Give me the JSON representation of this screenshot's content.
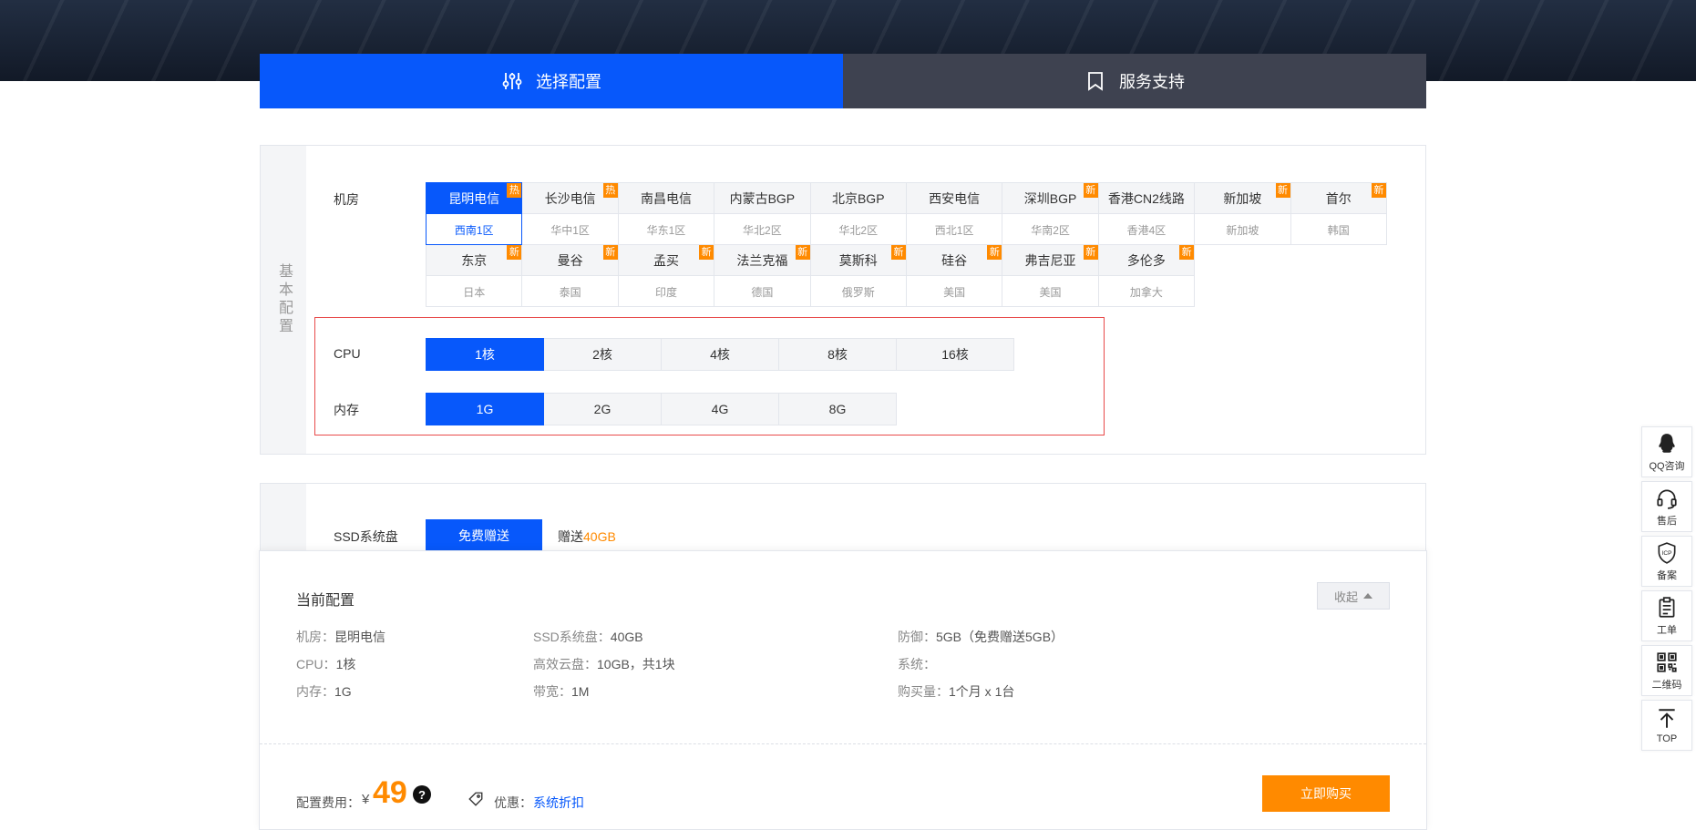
{
  "tabs": [
    {
      "label": "选择配置",
      "icon": "sliders-icon",
      "active": true
    },
    {
      "label": "服务支持",
      "icon": "bookmark-icon",
      "active": false
    }
  ],
  "basic": {
    "side_label": "基本配置",
    "datacenter_label": "机房",
    "datacenters": [
      [
        {
          "name": "昆明电信",
          "zone": "西南1区",
          "badge": "热",
          "selected": true
        },
        {
          "name": "长沙电信",
          "zone": "华中1区",
          "badge": "热"
        },
        {
          "name": "南昌电信",
          "zone": "华东1区",
          "badge": ""
        },
        {
          "name": "内蒙古BGP",
          "zone": "华北2区",
          "badge": ""
        },
        {
          "name": "北京BGP",
          "zone": "华北2区",
          "badge": ""
        },
        {
          "name": "西安电信",
          "zone": "西北1区",
          "badge": ""
        },
        {
          "name": "深圳BGP",
          "zone": "华南2区",
          "badge": "新"
        },
        {
          "name": "香港CN2线路",
          "zone": "香港4区",
          "badge": ""
        },
        {
          "name": "新加坡",
          "zone": "新加坡",
          "badge": "新"
        },
        {
          "name": "首尔",
          "zone": "韩国",
          "badge": "新"
        }
      ],
      [
        {
          "name": "东京",
          "zone": "日本",
          "badge": "新"
        },
        {
          "name": "曼谷",
          "zone": "泰国",
          "badge": "新"
        },
        {
          "name": "孟买",
          "zone": "印度",
          "badge": "新"
        },
        {
          "name": "法兰克福",
          "zone": "德国",
          "badge": "新"
        },
        {
          "name": "莫斯科",
          "zone": "俄罗斯",
          "badge": "新"
        },
        {
          "name": "硅谷",
          "zone": "美国",
          "badge": "新"
        },
        {
          "name": "弗吉尼亚",
          "zone": "美国",
          "badge": "新"
        },
        {
          "name": "多伦多",
          "zone": "加拿大",
          "badge": "新"
        }
      ]
    ],
    "cpu_label": "CPU",
    "cpu_options": [
      "1核",
      "2核",
      "4核",
      "8核",
      "16核"
    ],
    "cpu_selected": 0,
    "mem_label": "内存",
    "mem_options": [
      "1G",
      "2G",
      "4G",
      "8G"
    ],
    "mem_selected": 0
  },
  "storage": {
    "ssd_label": "SSD系统盘",
    "ssd_free": "免费赠送",
    "ssd_gift_prefix": "赠送",
    "ssd_gift_value": "40GB"
  },
  "config": {
    "title": "当前配置",
    "collapse": "收起",
    "col1": [
      {
        "k": "机房：",
        "v": "昆明电信"
      },
      {
        "k": "CPU：",
        "v": "1核"
      },
      {
        "k": "内存：",
        "v": "1G"
      }
    ],
    "col2": [
      {
        "k": "SSD系统盘：",
        "v": "40GB"
      },
      {
        "k": "高效云盘：",
        "v": "10GB，共1块"
      },
      {
        "k": "带宽：",
        "v": "1M"
      }
    ],
    "col3": [
      {
        "k": "防御：",
        "v": "5GB（免费赠送5GB）"
      },
      {
        "k": "系统：",
        "v": ""
      },
      {
        "k": "购买量：",
        "v": "1个月 x 1台"
      }
    ],
    "fee_label": "配置费用：",
    "currency": "¥",
    "fee_amount": "49",
    "help": "?",
    "promo_label": "优惠：",
    "promo_link": "系统折扣",
    "buy": "立即购买"
  },
  "float_bar": [
    {
      "icon": "qq-icon",
      "label": "QQ咨询"
    },
    {
      "icon": "headset-icon",
      "label": "售后"
    },
    {
      "icon": "icp-shield-icon",
      "label": "备案"
    },
    {
      "icon": "clipboard-icon",
      "label": "工单"
    },
    {
      "icon": "qrcode-icon",
      "label": "二维码"
    },
    {
      "icon": "arrow-top-icon",
      "label": "TOP"
    }
  ],
  "colors": {
    "primary": "#0758fb",
    "accent": "#ff8a00",
    "tab_inactive": "#3e4250"
  }
}
